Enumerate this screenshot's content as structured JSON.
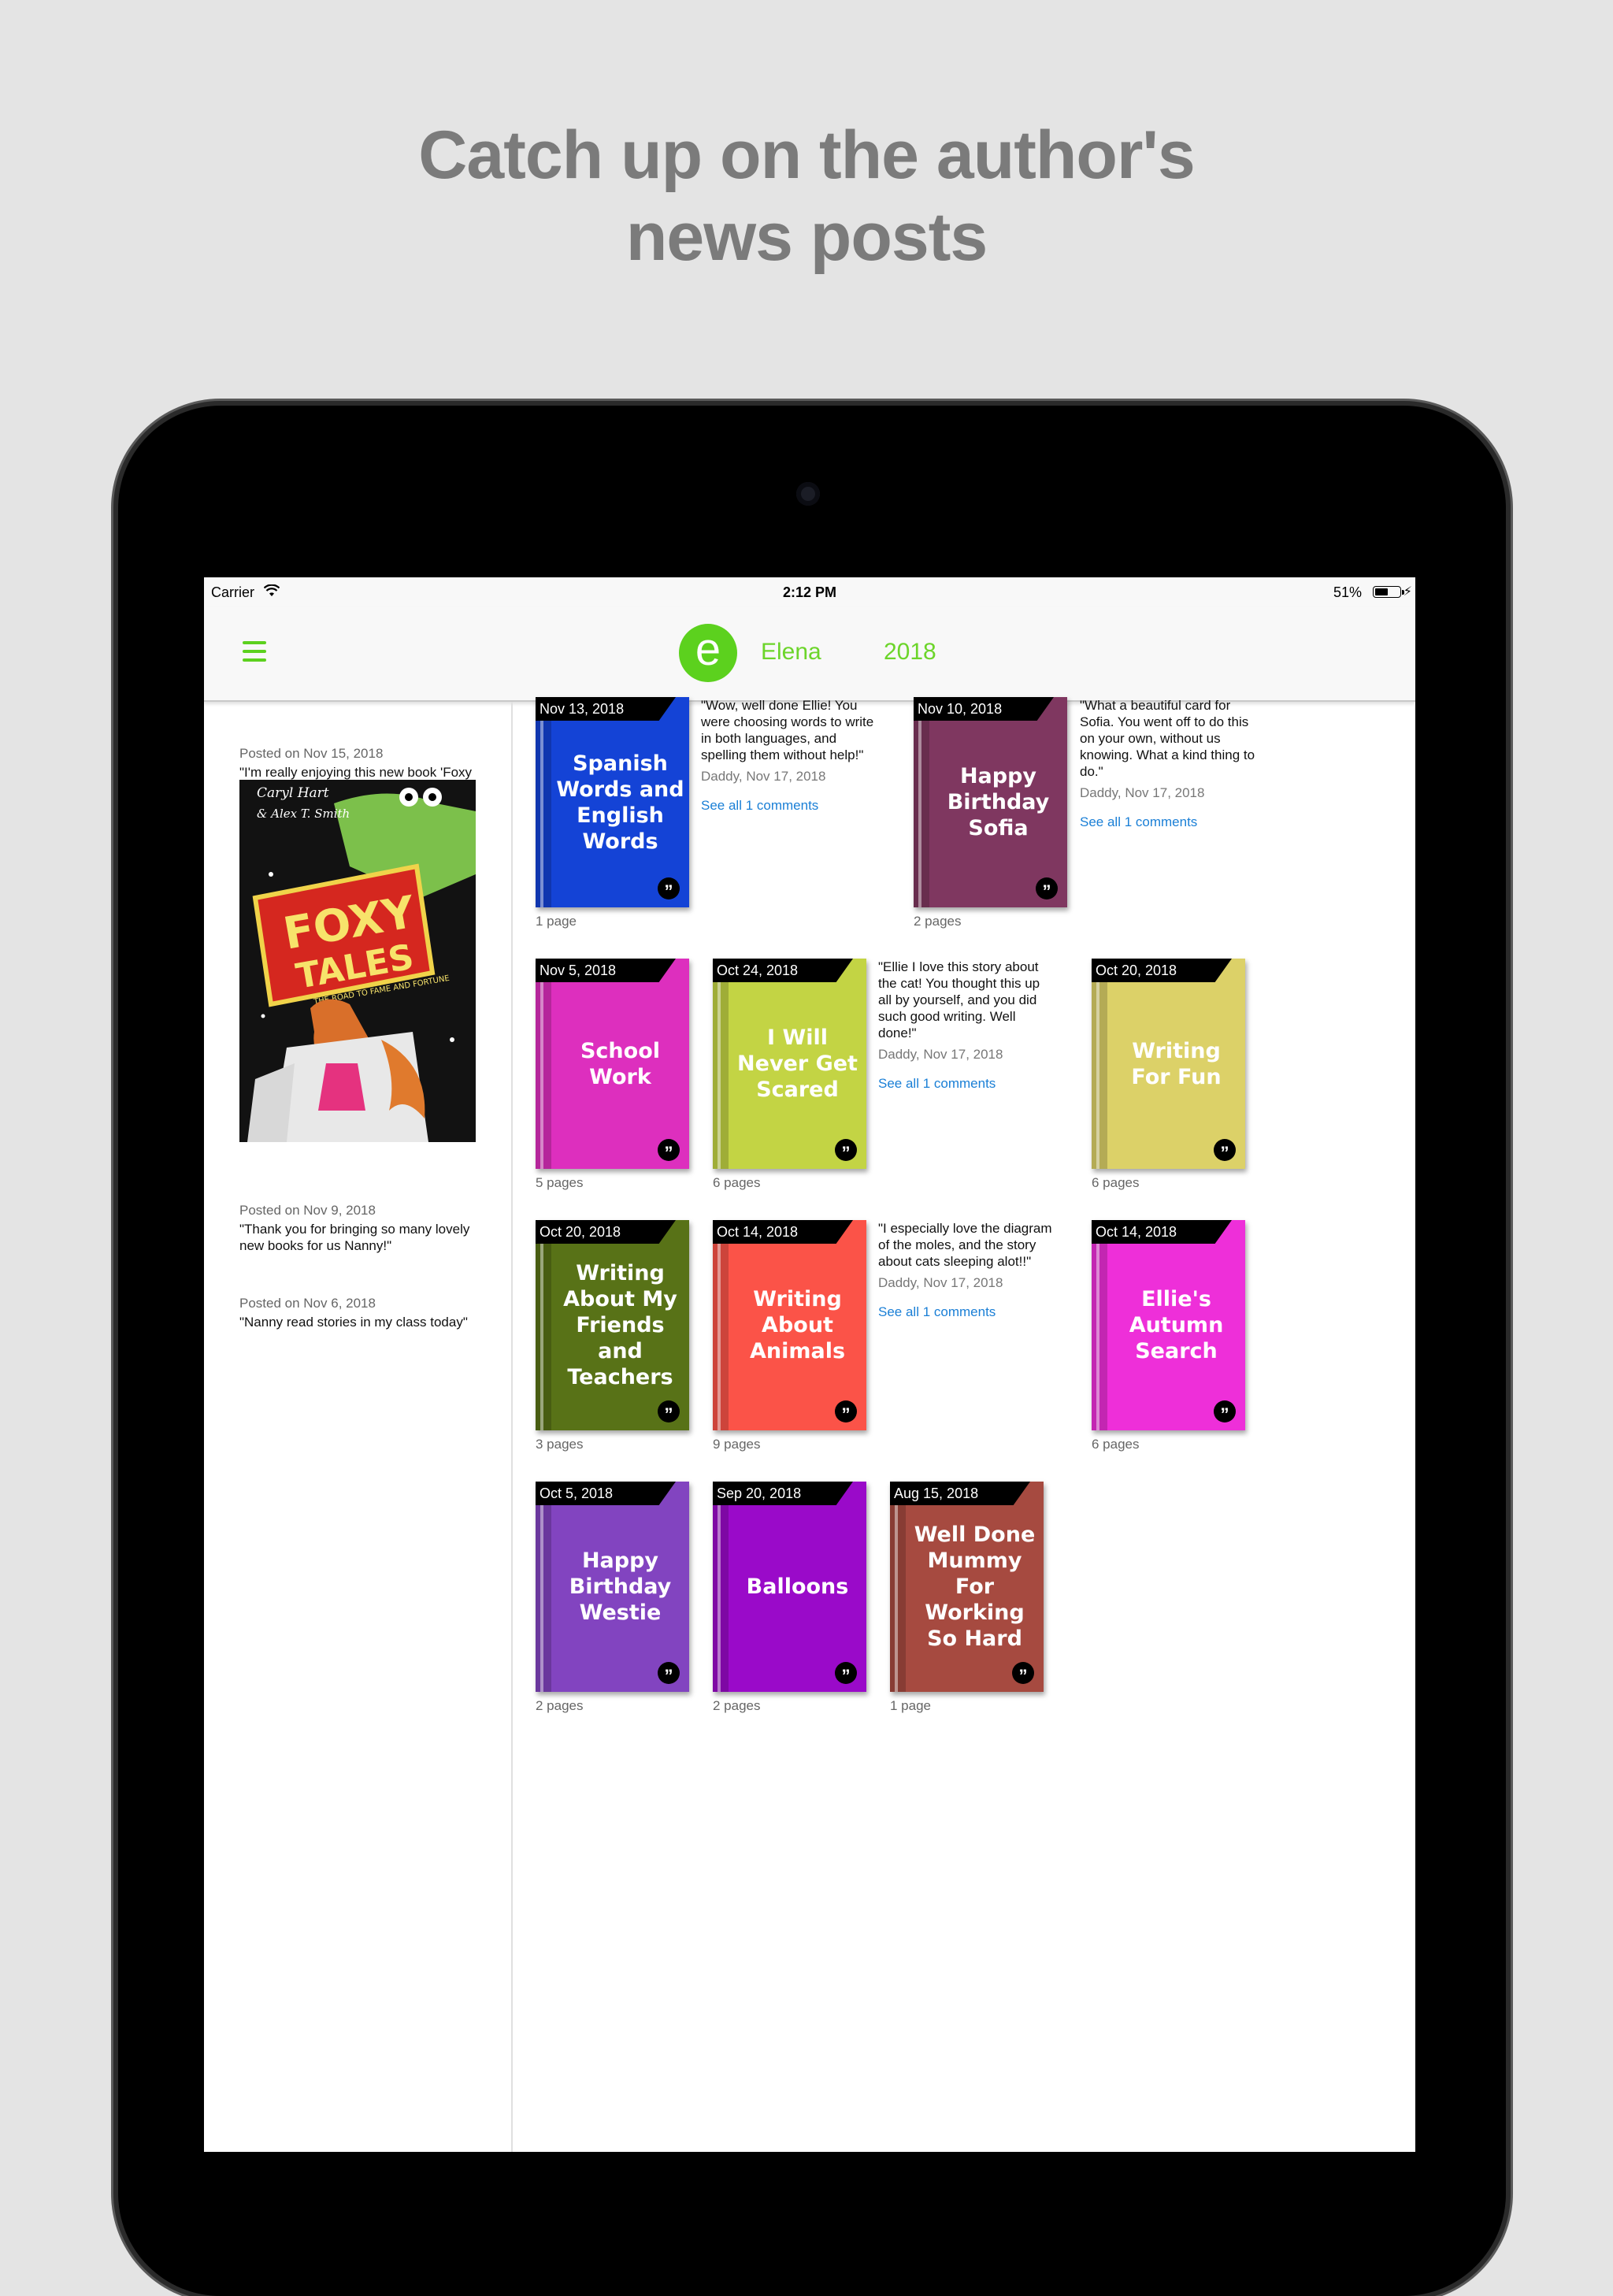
{
  "headline": {
    "line1": "Catch up on the author's",
    "line2": "news posts"
  },
  "status_bar": {
    "carrier": "Carrier",
    "time": "2:12 PM",
    "battery": "51%"
  },
  "nav": {
    "logo_letter": "e",
    "name": "Elena",
    "year": "2018",
    "accent_color": "#5cd11e"
  },
  "posts": [
    {
      "date": "Posted on Nov 15, 2018",
      "text": "\"I'm really enjoying this new book 'Foxy Tales' at bed time!\""
    },
    {
      "date": "Posted on Nov 9, 2018",
      "text": "\"Thank you for bringing so many lovely new books for us Nanny!\""
    },
    {
      "date": "Posted on Nov 6, 2018",
      "text": "\"Nanny read stories in my class today\""
    }
  ],
  "foxy_cover": {
    "author1": "Caryl Hart",
    "author_sep": "& Alex T. Smith",
    "title1": "FOXY",
    "title2": "TALES",
    "subtitle": "THE ROAD TO FAME AND FORTUNE"
  },
  "books": [
    {
      "date": "Nov 13, 2018",
      "title": "Spanish Words and English Words",
      "pages": "1 page",
      "color": "#1443d6"
    },
    {
      "date": "Nov 10, 2018",
      "title": "Happy Birthday Sofia",
      "pages": "2 pages",
      "color": "#7f3760"
    },
    {
      "date": "Nov 5, 2018",
      "title": "School Work",
      "pages": "5 pages",
      "color": "#dd2fbe"
    },
    {
      "date": "Oct 24, 2018",
      "title": "I Will Never Get Scared",
      "pages": "6 pages",
      "color": "#c3d444"
    },
    {
      "date": "Oct 20, 2018",
      "title": "Writing For Fun",
      "pages": "6 pages",
      "color": "#dcd168"
    },
    {
      "date": "Oct 20, 2018",
      "title": "Writing About My Friends and Teachers",
      "pages": "3 pages",
      "color": "#587217"
    },
    {
      "date": "Oct 14, 2018",
      "title": "Writing About Animals",
      "pages": "9 pages",
      "color": "#fb5348"
    },
    {
      "date": "Oct 14, 2018",
      "title": "Ellie's Autumn Search",
      "pages": "6 pages",
      "color": "#ee2fd9"
    },
    {
      "date": "Oct 5, 2018",
      "title": "Happy Birthday Westie",
      "pages": "2 pages",
      "color": "#8244c0"
    },
    {
      "date": "Sep 20, 2018",
      "title": "Balloons",
      "pages": "2 pages",
      "color": "#9a0ac9"
    },
    {
      "date": "Aug 15, 2018",
      "title": "Well Done Mummy For Working So Hard",
      "pages": "1 page",
      "color": "#a64a40"
    }
  ],
  "comments": [
    {
      "text": "\"Wow, well done Ellie! You were choosing words to write in both languages, and spelling them without help!\"",
      "by": "Daddy, Nov 17, 2018",
      "link": "See all 1 comments"
    },
    {
      "text": "\"What a beautiful card for Sofia. You went off to do this on your own, without us knowing. What a kind thing to do.\"",
      "by": "Daddy, Nov 17, 2018",
      "link": "See all 1 comments"
    },
    {
      "text": "\"Ellie I love this story about the cat! You thought this up all by yourself, and you did such good writing. Well done!\"",
      "by": "Daddy, Nov 17, 2018",
      "link": "See all 1 comments"
    },
    {
      "text": "\"I especially love the diagram of the moles, and the story about cats sleeping alot!!\"",
      "by": "Daddy, Nov 17, 2018",
      "link": "See all 1 comments"
    }
  ]
}
